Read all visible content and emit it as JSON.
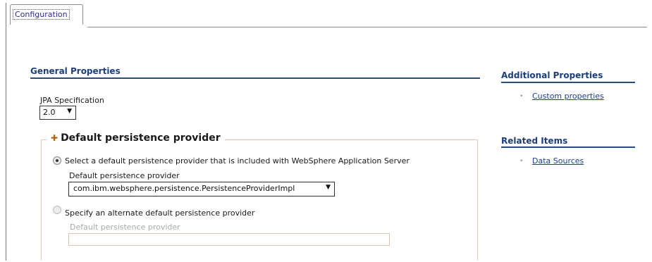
{
  "tabs": [
    {
      "label": "Configuration"
    }
  ],
  "general": {
    "heading": "General Properties",
    "jpa_label": "JPA Specification",
    "jpa_value": "2.0",
    "persistence": {
      "legend": "Default persistence provider",
      "option1_label": "Select a default persistence provider that is included with WebSphere Application Server",
      "option1_field_label": "Default persistence provider",
      "option1_value": "com.ibm.websphere.persistence.PersistenceProviderImpl",
      "option2_label": "Specify an alternate default persistence provider",
      "option2_field_label": "Default persistence provider",
      "option2_value": ""
    }
  },
  "sidebar": {
    "additional_heading": "Additional Properties",
    "additional_links": [
      {
        "label": "Custom properties"
      }
    ],
    "related_heading": "Related Items",
    "related_links": [
      {
        "label": "Data Sources"
      }
    ]
  },
  "colors": {
    "heading": "#1c3f7a",
    "link": "#1a3f90",
    "accent": "#b06010"
  }
}
